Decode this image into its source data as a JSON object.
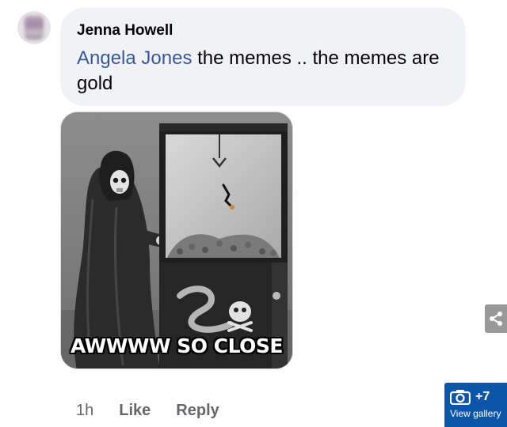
{
  "comment": {
    "author": "Jenna Howell",
    "mention": "Angela Jones",
    "text": " the memes .. the memes are gold",
    "time": "1h",
    "like_label": "Like",
    "reply_label": "Reply"
  },
  "meme": {
    "caption": "AWWWW SO CLOSE"
  },
  "gallery": {
    "count": "+7",
    "label": "View gallery"
  },
  "icons": {
    "share": "share-icon",
    "camera": "camera-icon"
  },
  "colors": {
    "bubble": "#f0f2f5",
    "mention": "#385898",
    "meta": "#65676b",
    "gallery": "#0c55a8"
  }
}
